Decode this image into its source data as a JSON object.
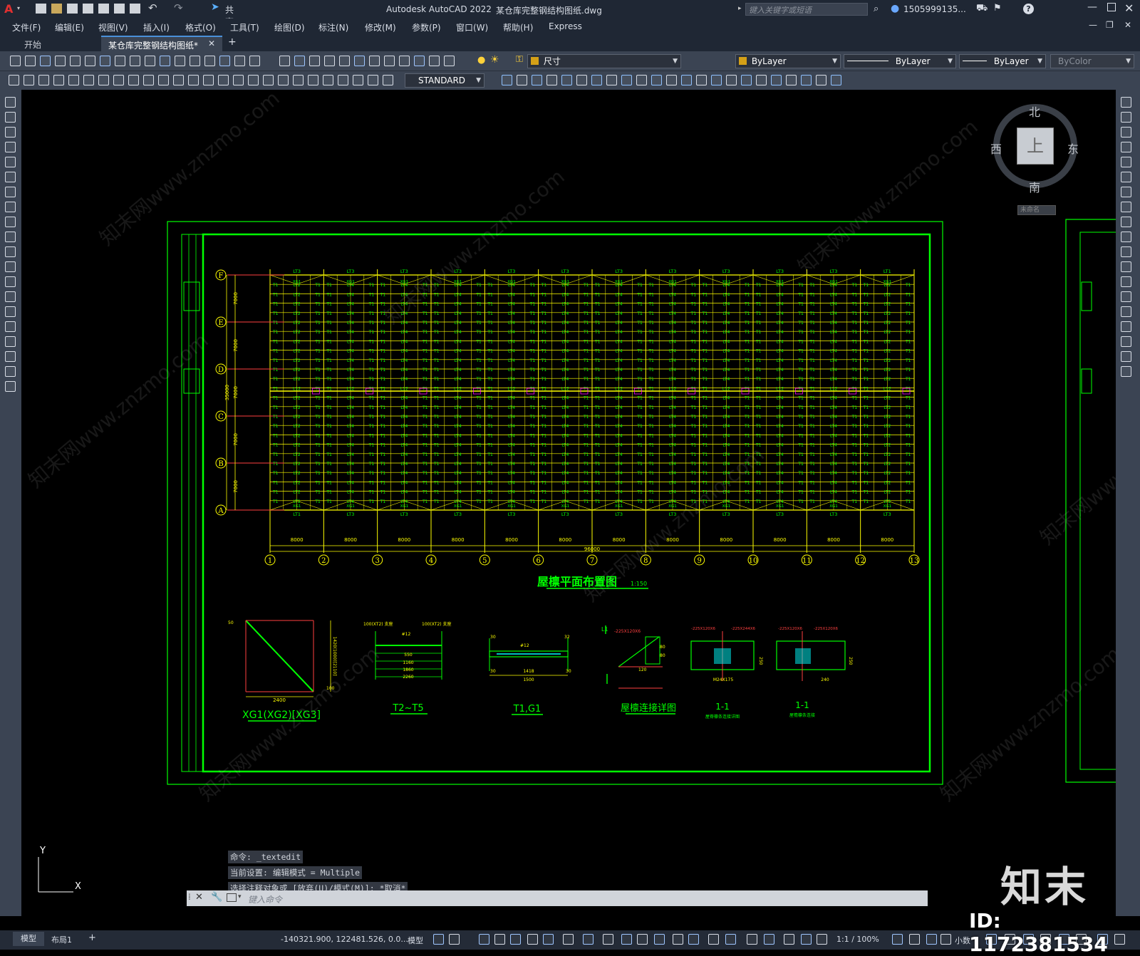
{
  "app": {
    "title": "Autodesk AutoCAD 2022",
    "filename": "某仓库完整钢结构图纸.dwg",
    "share_label": "共享",
    "search_placeholder": "键入关键字或短语",
    "user": "1505999135...",
    "window_controls": [
      "minimize-icon",
      "maximize-icon",
      "close-icon"
    ]
  },
  "menu": [
    "文件(F)",
    "编辑(E)",
    "视图(V)",
    "插入(I)",
    "格式(O)",
    "工具(T)",
    "绘图(D)",
    "标注(N)",
    "修改(M)",
    "参数(P)",
    "窗口(W)",
    "帮助(H)",
    "Express"
  ],
  "tabs": {
    "start": "开始",
    "active": "某仓库完整钢结构图纸*",
    "add": "+"
  },
  "toolbar": {
    "layer_name": "尺寸",
    "color": "ByLayer",
    "linetype": "ByLayer",
    "lineweight": "ByLayer",
    "plotstyle": "ByColor",
    "text_style": "STANDARD",
    "layer_color": "#d4a017"
  },
  "viewcube": {
    "north": "北",
    "south": "南",
    "east": "东",
    "west": "西",
    "top": "上",
    "wcs": "未命名"
  },
  "drawing": {
    "plan_title": "屋檩平面布置图",
    "plan_scale": "1:150",
    "total_length": "96000",
    "bay": "8000",
    "row_dim": "7000",
    "total_width": "35000",
    "axes_x": [
      "1",
      "2",
      "3",
      "4",
      "5",
      "6",
      "7",
      "8",
      "9",
      "10",
      "11",
      "12",
      "13"
    ],
    "axes_y": [
      "F",
      "E",
      "D",
      "C",
      "B",
      "A"
    ],
    "purlin_labels": [
      "LT3",
      "LT1",
      "T1",
      "LT2",
      "LT4",
      "XG1",
      "LT2F",
      "L12",
      "G1"
    ],
    "details": [
      {
        "title": "XG1(XG2)[XG3]",
        "dims": [
          "2400",
          "1420(1000)[2110]",
          "50",
          "100"
        ]
      },
      {
        "title": "T2~T5",
        "dims": [
          "550",
          "1160",
          "1860",
          "2260",
          "#12",
          "100(XT2) 支座",
          "100(XT2) 支座",
          "40",
          "30"
        ]
      },
      {
        "title": "T1,G1",
        "dims": [
          "1418",
          "1500",
          "32",
          "30",
          "30",
          "#12",
          "30"
        ]
      },
      {
        "title": "屋檩连接详图",
        "dims": [
          "-225X120X6",
          "150",
          "80",
          "80",
          "120",
          "L1"
        ]
      },
      {
        "title": "1-1",
        "subtitle": "屋脊檩条连接详图",
        "dims": [
          "-225X120X6",
          "-225X244X6",
          "250",
          "200",
          "40",
          "160",
          "M24X175"
        ]
      },
      {
        "title": "1-1",
        "subtitle": "屋檐檩条连接",
        "dims": [
          "-225X120X6",
          "-225X120X6",
          "250",
          "240",
          "90",
          "160",
          "M24X175"
        ]
      }
    ],
    "watermark": "知末网www.znzmo.com"
  },
  "command": {
    "history": [
      "命令: _textedit",
      "当前设置: 编辑模式 = Multiple",
      "选择注释对象或 [放弃(U)/模式(M)]: *取消*"
    ],
    "placeholder": "键入命令"
  },
  "ucs": {
    "x": "X",
    "y": "Y"
  },
  "status": {
    "model_tab": "模型",
    "layout_tab": "布局1",
    "add_tab": "+",
    "coords": "-140321.900, 122481.526, 0.0...",
    "space": "模型",
    "scale": "1:1 / 100%",
    "units": "小数"
  },
  "brand": {
    "logo": "知末",
    "id_text": "ID: 1172381534"
  },
  "colors": {
    "frame": "#00ff00",
    "grid": "#ffff00",
    "axis": "#ff4040",
    "purlin_text": "#00ff00",
    "magenta": "#ff00ff",
    "dim": "#ffff00"
  }
}
